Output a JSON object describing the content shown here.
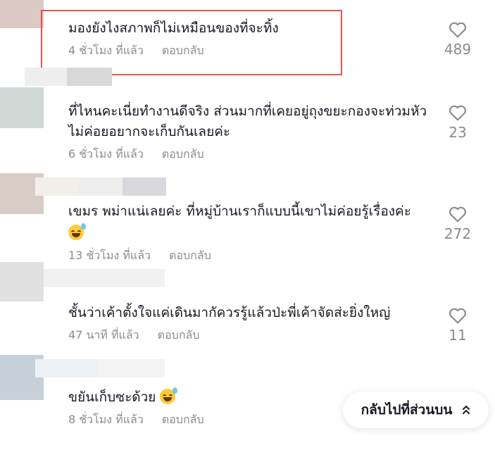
{
  "comments": [
    {
      "text": "มองยังไงสภาพก็ไม่เหมือนของที่จะทิ้ง",
      "time": "4 ชั่วโมง ที่แล้ว",
      "reply": "ตอบกลับ",
      "likes": "489",
      "emoji": false
    },
    {
      "text": "ที่ไหนคะเนี่ยทำงานดีจริง ส่วนมากที่เคยอยู่ถุงขยะกองจะท่วมหัวไม่ค่อยอยากจะเก็บกันเลยค่ะ",
      "time": "6 ชั่วโมง ที่แล้ว",
      "reply": "ตอบกลับ",
      "likes": "23",
      "emoji": false
    },
    {
      "text": "เขมร พม่าแน่เลยค่ะ ที่หมู่บ้านเราก็แบบนี้เขาไม่ค่อยรู้เรื่องค่ะ",
      "time": "13 ชั่วโมง ที่แล้ว",
      "reply": "ตอบกลับ",
      "likes": "272",
      "emoji": true
    },
    {
      "text": "ชั้นว่าเค้าตั้งใจแค่เดินมากัควรรู้แล้วป่ะพี่เค้าจัดส่ะยิ่งใหญ่",
      "time": "47 นาที ที่แล้ว",
      "reply": "ตอบกลับ",
      "likes": "11",
      "emoji": false
    },
    {
      "text": "ขยันเก็บซะด้วย",
      "time": "8 ชั่วโมง ที่แล้ว",
      "reply": "ตอบกลับ",
      "likes": "",
      "emoji": true
    }
  ],
  "back_to_top": {
    "label": "กลับไปที่ส่วนบน"
  },
  "icons": {
    "like": "heart-outline-icon",
    "back_to_top": "double-chevron-up-icon",
    "emoji": "grinning-sweat-emoji"
  },
  "colors": {
    "highlight": "#e05555",
    "meta": "#8a8b91",
    "text": "#161823"
  }
}
